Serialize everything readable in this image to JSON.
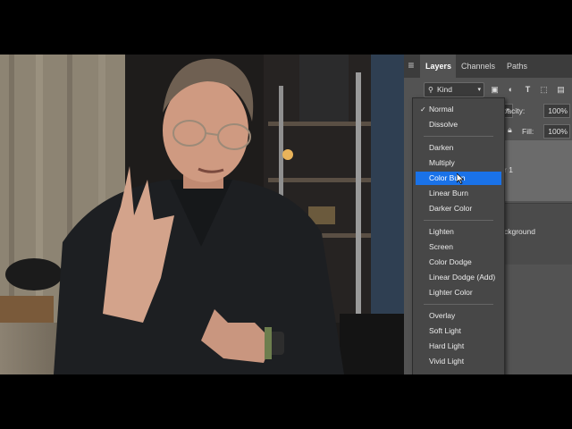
{
  "panel": {
    "menu_icon": "hamburger-icon",
    "tabs": [
      {
        "label": "Layers"
      },
      {
        "label": "Channels"
      },
      {
        "label": "Paths"
      }
    ],
    "filter": {
      "kind_label": "Kind",
      "icons": [
        "image-filter-icon",
        "adjustment-filter-icon",
        "type-filter-icon",
        "shape-filter-icon",
        "smart-object-filter-icon"
      ]
    },
    "opacity_label": "Opacity:",
    "opacity_value": "100%",
    "fill_label": "Fill:",
    "fill_value": "100%",
    "layers": [
      {
        "name": "r 1"
      },
      {
        "name": "ckground"
      }
    ]
  },
  "blend_menu": {
    "selected": "Normal",
    "highlighted": "Color Burn",
    "groups": [
      [
        "Normal",
        "Dissolve"
      ],
      [
        "Darken",
        "Multiply",
        "Color Burn",
        "Linear Burn",
        "Darker Color"
      ],
      [
        "Lighten",
        "Screen",
        "Color Dodge",
        "Linear Dodge (Add)",
        "Lighter Color"
      ],
      [
        "Overlay",
        "Soft Light",
        "Hard Light",
        "Vivid Light"
      ]
    ],
    "check_mark": "✓"
  },
  "colors": {
    "highlight": "#1a72e8",
    "panel_bg": "#535353",
    "menu_bg": "#474747"
  }
}
